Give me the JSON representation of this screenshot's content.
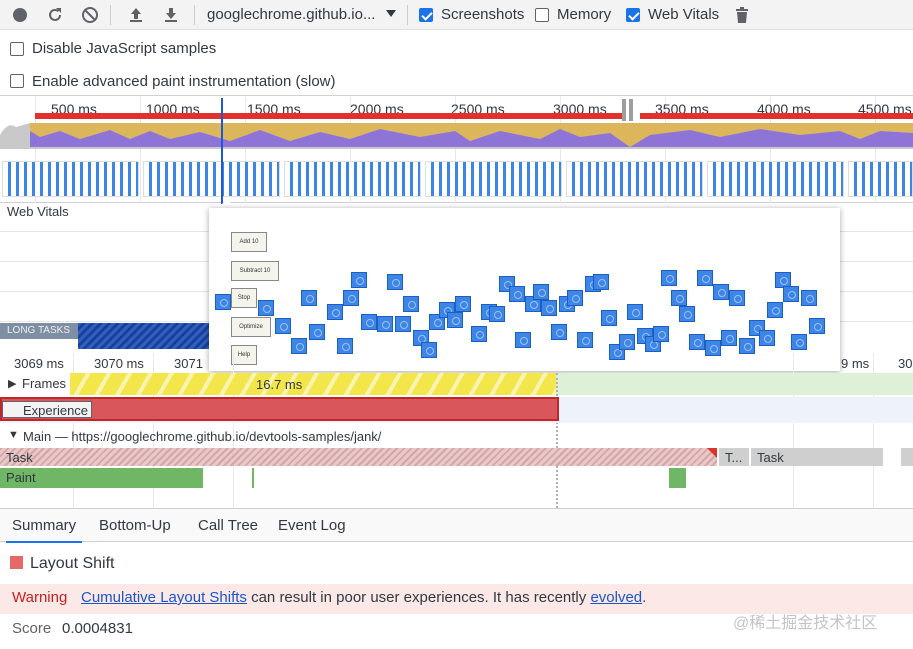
{
  "toolbar": {
    "url": "googlechrome.github.io...",
    "screenshots_label": "Screenshots",
    "memory_label": "Memory",
    "webvitals_label": "Web Vitals",
    "screenshots_checked": true,
    "memory_checked": false,
    "webvitals_checked": true
  },
  "options": {
    "disable_js_samples": "Disable JavaScript samples",
    "advanced_paint": "Enable advanced paint instrumentation (slow)"
  },
  "overview": {
    "ruler": [
      "500 ms",
      "1000 ms",
      "1500 ms",
      "2000 ms",
      "2500 ms",
      "3000 ms",
      "3500 ms",
      "4000 ms",
      "4500 ms"
    ]
  },
  "lanes": {
    "web_vitals": "Web Vitals",
    "long_tasks": "LONG TASKS"
  },
  "popover": {
    "buttons": [
      "Add 10",
      "Subtract 10",
      "Stop",
      "Optimize",
      "Help"
    ]
  },
  "detail_ruler": [
    "3069 ms",
    "3070 ms",
    "3071",
    "9 ms",
    "30"
  ],
  "tracks": {
    "frames_label": "Frames",
    "frame_duration": "16.7 ms",
    "experience_label": "Experience",
    "main_label": "Main — https://googlechrome.github.io/devtools-samples/jank/",
    "task1": "Task",
    "task2": "T...",
    "task3": "Task",
    "paint": "Paint"
  },
  "tabs": [
    "Summary",
    "Bottom-Up",
    "Call Tree",
    "Event Log"
  ],
  "summary": {
    "title": "Layout Shift",
    "warning_label": "Warning",
    "link1": "Cumulative Layout Shifts",
    "warning_text": " can result in poor user experiences. It has recently ",
    "link2": "evolved",
    "period": ".",
    "score_label": "Score",
    "score_value": "0.0004831"
  },
  "watermark": "@稀土掘金技术社区",
  "colors": {
    "accent": "#1a73e8",
    "frames_yellow": "#f2e64b",
    "experience_red": "#d9575a",
    "paint_green": "#6fb665",
    "warning_bg": "#fce8e6"
  }
}
